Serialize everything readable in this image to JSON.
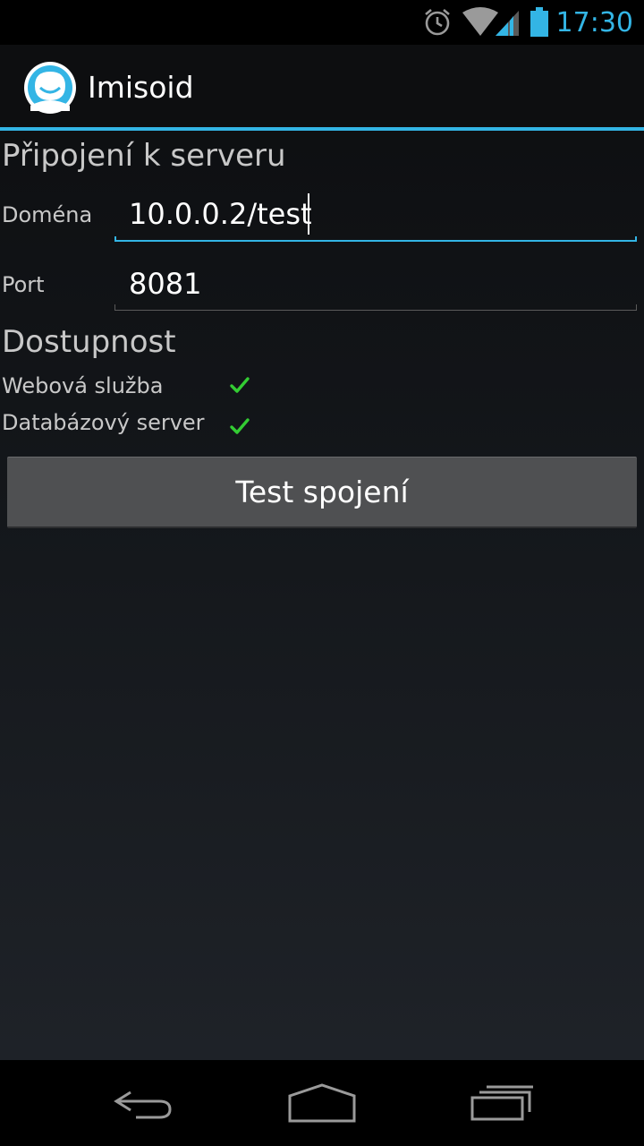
{
  "status_bar": {
    "time": "17:30",
    "icons": [
      "alarm-icon",
      "wifi-icon",
      "signal-icon",
      "battery-icon"
    ],
    "accent_color": "#33b5e5"
  },
  "action_bar": {
    "title": "Imisoid",
    "icon": "app-face-icon",
    "divider_color": "#33b5e5"
  },
  "connection": {
    "title": "Připojení k serveru",
    "domain_label": "Doména",
    "domain_value": "10.0.0.2/test",
    "port_label": "Port",
    "port_value": "8081"
  },
  "availability": {
    "title": "Dostupnost",
    "items": [
      {
        "label": "Webová služba",
        "status_icon": "check-icon",
        "status_color": "#33cc33"
      },
      {
        "label": "Databázový server",
        "status_icon": "check-icon",
        "status_color": "#33cc33"
      }
    ]
  },
  "actions": {
    "test_button_label": "Test spojení"
  },
  "nav_bar": {
    "icons": [
      "back-icon",
      "home-icon",
      "recent-apps-icon"
    ]
  }
}
